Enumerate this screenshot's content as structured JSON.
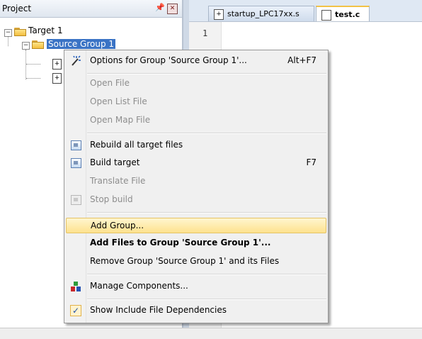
{
  "project_pane": {
    "title": "Project",
    "pin_glyph": "։",
    "close_glyph": "✖"
  },
  "tree": {
    "target_label": "Target 1",
    "group_label": "Source Group 1"
  },
  "editor": {
    "tabs": [
      {
        "label": "startup_LPC17xx.s",
        "active": false
      },
      {
        "label": "test.c",
        "active": true
      }
    ],
    "line_numbers": [
      "1"
    ]
  },
  "context_menu": {
    "items": [
      {
        "label": "Options for Group 'Source Group 1'...",
        "shortcut": "Alt+F7",
        "enabled": true,
        "icon": "wand-icon"
      },
      {
        "label": "Open File",
        "enabled": false
      },
      {
        "label": "Open List File",
        "enabled": false
      },
      {
        "label": "Open Map File",
        "enabled": false
      },
      {
        "label": "Rebuild all target files",
        "enabled": true,
        "icon": "rebuild-icon"
      },
      {
        "label": "Build target",
        "shortcut": "F7",
        "enabled": true,
        "icon": "build-icon"
      },
      {
        "label": "Translate File",
        "enabled": false
      },
      {
        "label": "Stop build",
        "enabled": false,
        "icon": "stop-build-icon"
      },
      {
        "label": "Add Group...",
        "enabled": true,
        "highlighted": true
      },
      {
        "label": "Add Files to Group 'Source Group 1'...",
        "enabled": true,
        "bold": true
      },
      {
        "label": "Remove Group 'Source Group 1' and its Files",
        "enabled": true
      },
      {
        "label": "Manage Components...",
        "enabled": true,
        "icon": "components-icon"
      },
      {
        "label": "Show Include File Dependencies",
        "enabled": true,
        "checked": true,
        "icon": "checkmark-icon"
      }
    ]
  },
  "colors": {
    "selection": "#3a73c5",
    "highlight_start": "#fff6cf",
    "highlight_end": "#fde28e",
    "disabled_text": "#8d8d8d"
  }
}
